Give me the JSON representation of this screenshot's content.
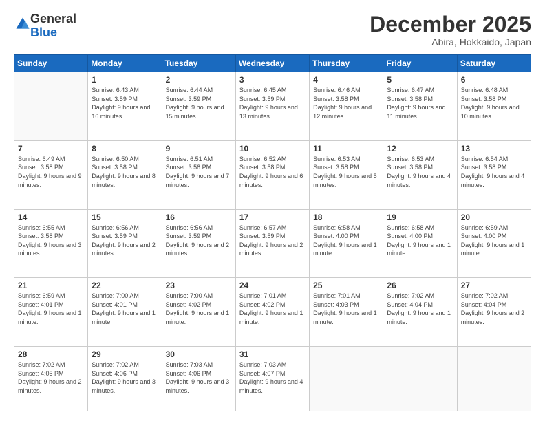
{
  "logo": {
    "general": "General",
    "blue": "Blue"
  },
  "header": {
    "month": "December 2025",
    "location": "Abira, Hokkaido, Japan"
  },
  "weekdays": [
    "Sunday",
    "Monday",
    "Tuesday",
    "Wednesday",
    "Thursday",
    "Friday",
    "Saturday"
  ],
  "weeks": [
    [
      {
        "day": "",
        "empty": true
      },
      {
        "day": "1",
        "sunrise": "6:43 AM",
        "sunset": "3:59 PM",
        "daylight": "9 hours and 16 minutes."
      },
      {
        "day": "2",
        "sunrise": "6:44 AM",
        "sunset": "3:59 PM",
        "daylight": "9 hours and 15 minutes."
      },
      {
        "day": "3",
        "sunrise": "6:45 AM",
        "sunset": "3:59 PM",
        "daylight": "9 hours and 13 minutes."
      },
      {
        "day": "4",
        "sunrise": "6:46 AM",
        "sunset": "3:58 PM",
        "daylight": "9 hours and 12 minutes."
      },
      {
        "day": "5",
        "sunrise": "6:47 AM",
        "sunset": "3:58 PM",
        "daylight": "9 hours and 11 minutes."
      },
      {
        "day": "6",
        "sunrise": "6:48 AM",
        "sunset": "3:58 PM",
        "daylight": "9 hours and 10 minutes."
      }
    ],
    [
      {
        "day": "7",
        "sunrise": "6:49 AM",
        "sunset": "3:58 PM",
        "daylight": "9 hours and 9 minutes."
      },
      {
        "day": "8",
        "sunrise": "6:50 AM",
        "sunset": "3:58 PM",
        "daylight": "9 hours and 8 minutes."
      },
      {
        "day": "9",
        "sunrise": "6:51 AM",
        "sunset": "3:58 PM",
        "daylight": "9 hours and 7 minutes."
      },
      {
        "day": "10",
        "sunrise": "6:52 AM",
        "sunset": "3:58 PM",
        "daylight": "9 hours and 6 minutes."
      },
      {
        "day": "11",
        "sunrise": "6:53 AM",
        "sunset": "3:58 PM",
        "daylight": "9 hours and 5 minutes."
      },
      {
        "day": "12",
        "sunrise": "6:53 AM",
        "sunset": "3:58 PM",
        "daylight": "9 hours and 4 minutes."
      },
      {
        "day": "13",
        "sunrise": "6:54 AM",
        "sunset": "3:58 PM",
        "daylight": "9 hours and 4 minutes."
      }
    ],
    [
      {
        "day": "14",
        "sunrise": "6:55 AM",
        "sunset": "3:58 PM",
        "daylight": "9 hours and 3 minutes."
      },
      {
        "day": "15",
        "sunrise": "6:56 AM",
        "sunset": "3:59 PM",
        "daylight": "9 hours and 2 minutes."
      },
      {
        "day": "16",
        "sunrise": "6:56 AM",
        "sunset": "3:59 PM",
        "daylight": "9 hours and 2 minutes."
      },
      {
        "day": "17",
        "sunrise": "6:57 AM",
        "sunset": "3:59 PM",
        "daylight": "9 hours and 2 minutes."
      },
      {
        "day": "18",
        "sunrise": "6:58 AM",
        "sunset": "4:00 PM",
        "daylight": "9 hours and 1 minute."
      },
      {
        "day": "19",
        "sunrise": "6:58 AM",
        "sunset": "4:00 PM",
        "daylight": "9 hours and 1 minute."
      },
      {
        "day": "20",
        "sunrise": "6:59 AM",
        "sunset": "4:00 PM",
        "daylight": "9 hours and 1 minute."
      }
    ],
    [
      {
        "day": "21",
        "sunrise": "6:59 AM",
        "sunset": "4:01 PM",
        "daylight": "9 hours and 1 minute."
      },
      {
        "day": "22",
        "sunrise": "7:00 AM",
        "sunset": "4:01 PM",
        "daylight": "9 hours and 1 minute."
      },
      {
        "day": "23",
        "sunrise": "7:00 AM",
        "sunset": "4:02 PM",
        "daylight": "9 hours and 1 minute."
      },
      {
        "day": "24",
        "sunrise": "7:01 AM",
        "sunset": "4:02 PM",
        "daylight": "9 hours and 1 minute."
      },
      {
        "day": "25",
        "sunrise": "7:01 AM",
        "sunset": "4:03 PM",
        "daylight": "9 hours and 1 minute."
      },
      {
        "day": "26",
        "sunrise": "7:02 AM",
        "sunset": "4:04 PM",
        "daylight": "9 hours and 1 minute."
      },
      {
        "day": "27",
        "sunrise": "7:02 AM",
        "sunset": "4:04 PM",
        "daylight": "9 hours and 2 minutes."
      }
    ],
    [
      {
        "day": "28",
        "sunrise": "7:02 AM",
        "sunset": "4:05 PM",
        "daylight": "9 hours and 2 minutes."
      },
      {
        "day": "29",
        "sunrise": "7:02 AM",
        "sunset": "4:06 PM",
        "daylight": "9 hours and 3 minutes."
      },
      {
        "day": "30",
        "sunrise": "7:03 AM",
        "sunset": "4:06 PM",
        "daylight": "9 hours and 3 minutes."
      },
      {
        "day": "31",
        "sunrise": "7:03 AM",
        "sunset": "4:07 PM",
        "daylight": "9 hours and 4 minutes."
      },
      {
        "day": "",
        "empty": true
      },
      {
        "day": "",
        "empty": true
      },
      {
        "day": "",
        "empty": true
      }
    ]
  ]
}
